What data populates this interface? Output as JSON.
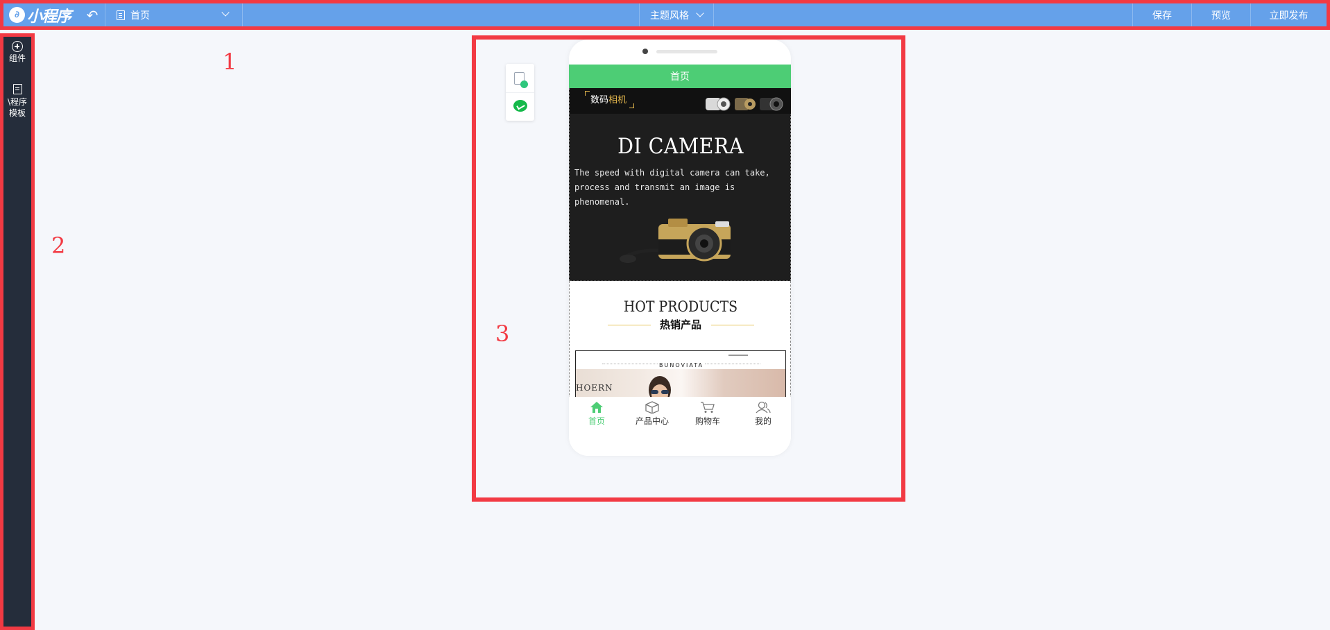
{
  "topbar": {
    "logo_text": "小程序",
    "page_select": "首页",
    "theme_label": "主题风格",
    "save_label": "保存",
    "preview_label": "预览",
    "publish_label": "立即发布"
  },
  "annotations": {
    "one": "1",
    "two": "2",
    "three": "3"
  },
  "sidebar": {
    "items": [
      {
        "label": "组件"
      },
      {
        "label": "小程序\n模板",
        "label_line1": "\\程序",
        "label_line2": "模板"
      }
    ]
  },
  "phone": {
    "nav_title": "首页",
    "hero": {
      "brand_prefix": "数码",
      "brand_highlight": "相机",
      "title": "DI CAMERA",
      "description": "The speed with digital camera can take, process and transmit an image is phenomenal."
    },
    "products": {
      "title": "HOT PRODUCTS",
      "subtitle": "热销产品",
      "banner_brand": "BUNOVIATA",
      "banner_text": "HOERN"
    },
    "tabs": [
      {
        "label": "首页",
        "icon": "home-icon",
        "active": true
      },
      {
        "label": "产品中心",
        "icon": "box-icon",
        "active": false
      },
      {
        "label": "购物车",
        "icon": "cart-icon",
        "active": false
      },
      {
        "label": "我的",
        "icon": "user-icon",
        "active": false
      }
    ]
  },
  "colors": {
    "topbar": "#65a1ea",
    "highlight_border": "#f23a43",
    "sidebar": "#252d3b",
    "accent_green": "#4dcd75",
    "gold": "#e3b64c"
  }
}
